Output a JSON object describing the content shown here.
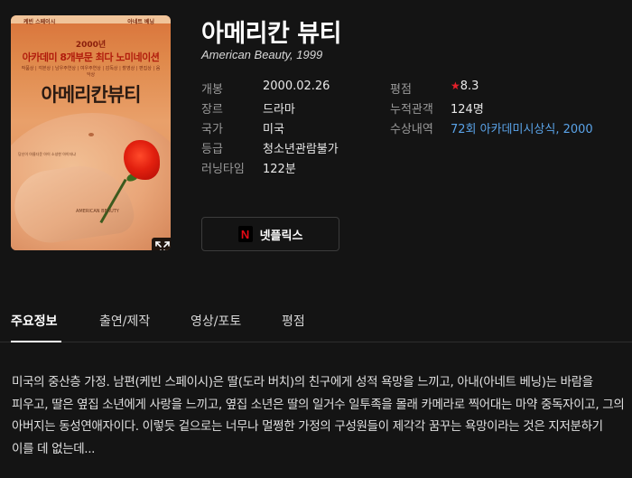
{
  "poster": {
    "top_left_name": "케빈 스페이시",
    "top_right_name": "아네트 베닝",
    "year_banner": "2000년",
    "award_banner": "아카데미 8개부문 최다 노미네이션",
    "nominees_line": "작품상 | 각본상 | 남우주연상 | 여우주연상 | 감독상 | 촬영상 | 편집상 | 음악상",
    "title": "아메리칸뷰티",
    "tagline": "당신이 아름다운 아이 소성한 아이더냐",
    "caption": "AMERICAN BEAUTY"
  },
  "movie": {
    "title_ko": "아메리칸 뷰티",
    "title_en_year": "American Beauty, 1999"
  },
  "info_left": [
    {
      "label": "개봉",
      "value": "2000.02.26"
    },
    {
      "label": "장르",
      "value": "드라마"
    },
    {
      "label": "국가",
      "value": "미국"
    },
    {
      "label": "등급",
      "value": "청소년관람불가"
    },
    {
      "label": "러닝타임",
      "value": "122분"
    }
  ],
  "info_right": {
    "rating_label": "평점",
    "rating_value": "8.3",
    "audience_label": "누적관객",
    "audience_value": "124명",
    "awards_label": "수상내역",
    "awards_value": "72회 아카데미시상식, 2000"
  },
  "colors": {
    "background": "#141414",
    "accent_red": "#e5202a",
    "link_blue": "#5aa3e8"
  },
  "streaming": {
    "netflix_label": "넷플릭스",
    "netflix_icon_letter": "N"
  },
  "tabs": [
    {
      "label": "주요정보",
      "active": true
    },
    {
      "label": "출연/제작",
      "active": false
    },
    {
      "label": "영상/포토",
      "active": false
    },
    {
      "label": "평점",
      "active": false
    }
  ],
  "synopsis": "미국의 중산층 가정. 남편(케빈 스페이시)은 딸(도라 버치)의 친구에게 성적 욕망을 느끼고, 아내(아네트 베닝)는 바람을 피우고, 딸은 옆집 소년에게 사랑을 느끼고, 옆집 소년은 딸의 일거수 일투족을 몰래 카메라로 찍어대는 마약 중독자이고, 그의 아버지는 동성연애자이다. 이렇듯 겉으로는 너무나 멀쩡한 가정의 구성원들이 제각각 꿈꾸는 욕망이라는 것은 지저분하기 이를 데 없는데..."
}
